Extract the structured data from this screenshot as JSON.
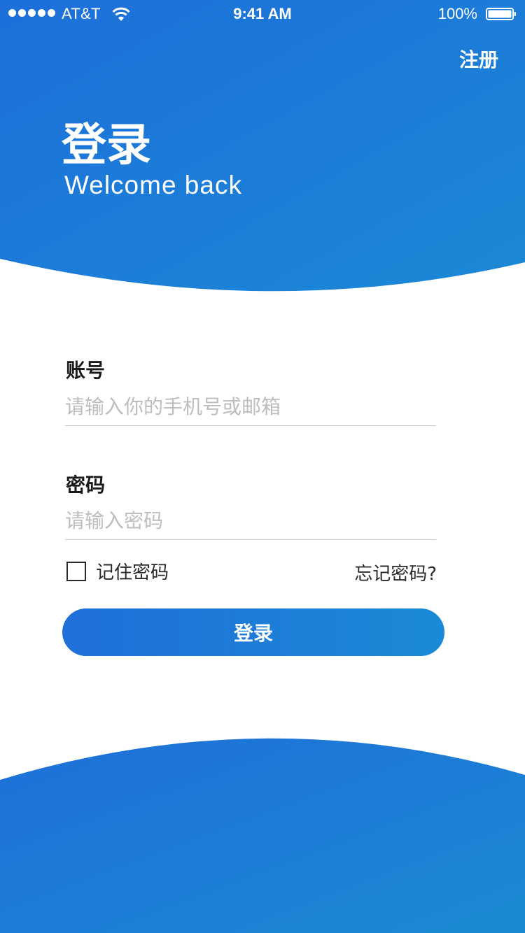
{
  "status_bar": {
    "carrier": "AT&T",
    "time": "9:41 AM",
    "battery": "100%",
    "icons": [
      "signal-dots-icon",
      "wifi-icon",
      "battery-icon"
    ]
  },
  "header": {
    "register_link": "注册",
    "title": "登录",
    "subtitle": "Welcome back"
  },
  "form": {
    "account": {
      "label": "账号",
      "placeholder": "请输入你的手机号或邮箱",
      "value": ""
    },
    "password": {
      "label": "密码",
      "placeholder": "请输入密码",
      "value": ""
    },
    "remember": {
      "label": "记住密码",
      "checked": false
    },
    "forgot_link": "忘记密码?",
    "submit_label": "登录"
  },
  "colors": {
    "brand_blue": "#1f6fd8",
    "brand_blue_light": "#1b8ad6",
    "text_dark": "#1a1a1a",
    "placeholder": "#bdbdbd",
    "background": "#ffffff"
  }
}
